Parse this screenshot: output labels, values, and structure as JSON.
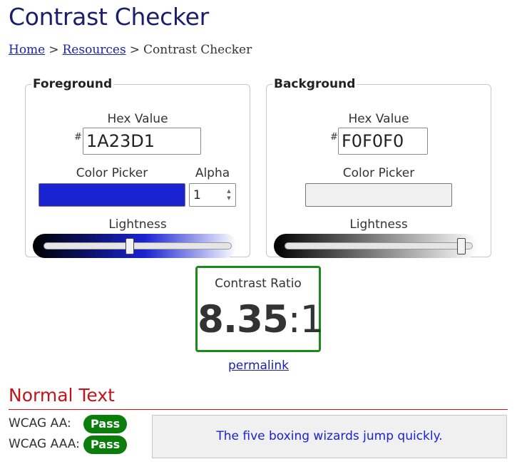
{
  "page": {
    "title": "Contrast Checker"
  },
  "breadcrumb": {
    "home": "Home",
    "sep1": ">",
    "resources": "Resources",
    "sep2": ">",
    "current": "Contrast Checker"
  },
  "foreground": {
    "legend": "Foreground",
    "hex_label": "Hex Value",
    "hash": "#",
    "hex_value": "1A23D1",
    "picker_label": "Color Picker",
    "alpha_label": "Alpha",
    "alpha_value": "1",
    "lightness_label": "Lightness",
    "swatch_color": "#1a23d1",
    "lightness_fraction": 0.46
  },
  "background": {
    "legend": "Background",
    "hex_label": "Hex Value",
    "hash": "#",
    "hex_value": "F0F0F0",
    "picker_label": "Color Picker",
    "lightness_label": "Lightness",
    "swatch_color": "#f0f0f0",
    "lightness_fraction": 0.94
  },
  "contrast": {
    "label": "Contrast Ratio",
    "ratio_main": "8.35",
    "ratio_suffix": ":1",
    "permalink": "permalink",
    "border_color": "#1a8a1a"
  },
  "normal_text": {
    "heading": "Normal Text",
    "aa_label": "WCAG AA:",
    "aa_result": "Pass",
    "aaa_label": "WCAG AAA:",
    "aaa_result": "Pass",
    "sample": "The five boxing wizards jump quickly.",
    "pass_color": "#0a7d0a",
    "heading_color": "#c0151a"
  }
}
